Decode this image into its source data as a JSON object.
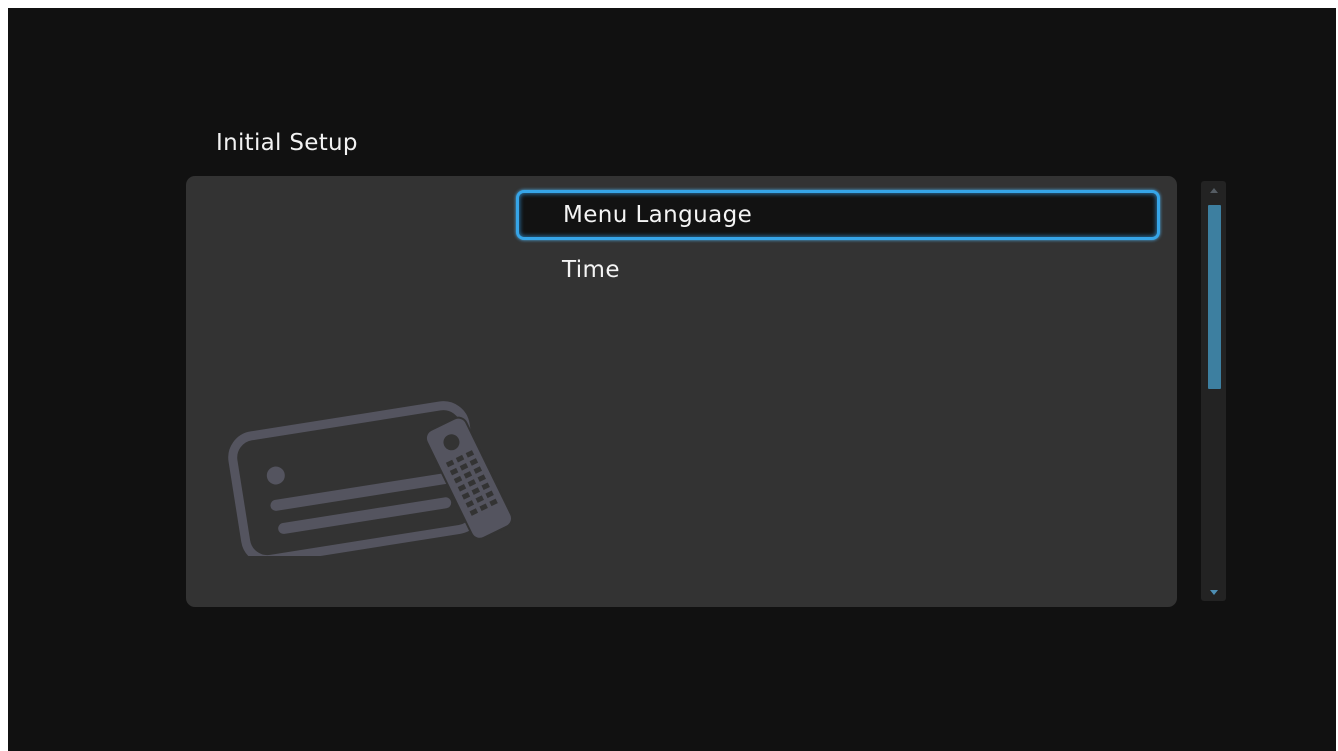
{
  "page": {
    "title": "Initial Setup"
  },
  "menu": {
    "items": [
      {
        "label": "Menu Language",
        "selected": true
      },
      {
        "label": "Time",
        "selected": false
      }
    ]
  },
  "scrollbar": {
    "position_fraction": 0.0,
    "visible_fraction": 0.46
  },
  "icons": {
    "illustration": "tv-remote-icon",
    "scroll_up": "triangle-up-icon",
    "scroll_down": "triangle-down-icon"
  },
  "colors": {
    "background": "#111111",
    "panel": "#333333",
    "accent": "#36a5e8",
    "scroll_thumb": "#3d7fa0",
    "illustration": "#54545f"
  }
}
